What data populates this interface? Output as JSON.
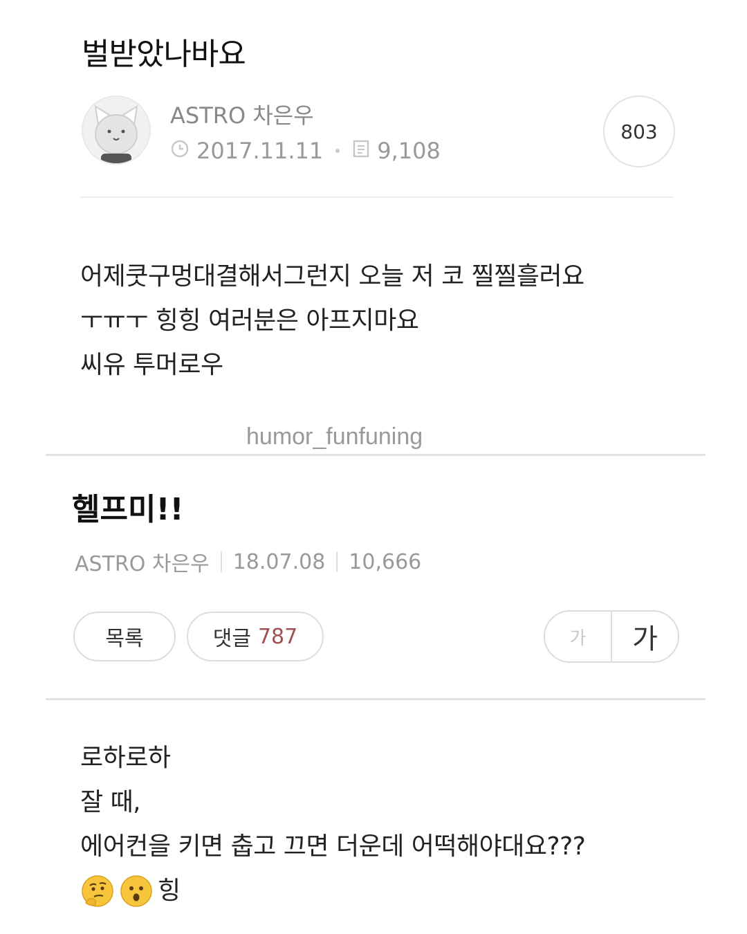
{
  "post1": {
    "title": "벌받았나바요",
    "author": "ASTRO 차은우",
    "date": "2017.11.11",
    "views": "9,108",
    "comment_count": "803",
    "body_lines": [
      "어제쿳구멍대결해서그런지 오늘 저 코 찔찔흘러요",
      "ㅜㅠㅜ 힝힝 여러분은 아프지마요",
      "씨유 투머로우"
    ]
  },
  "watermark": "humor_funfuning",
  "post2": {
    "title": "헬프미!!",
    "author": "ASTRO 차은우",
    "date": "18.07.08",
    "views": "10,666",
    "list_button": "목록",
    "comments_label": "댓글",
    "comments_count": "787",
    "font_small": "가",
    "font_large": "가",
    "body_lines": [
      "로하로하",
      "잘 때,",
      "에어컨을 키면 춥고 끄면 더운데 어떡해야대요???"
    ],
    "last_line_text": "힝",
    "emojis": [
      "thinking-face-icon",
      "surprised-face-icon"
    ]
  }
}
